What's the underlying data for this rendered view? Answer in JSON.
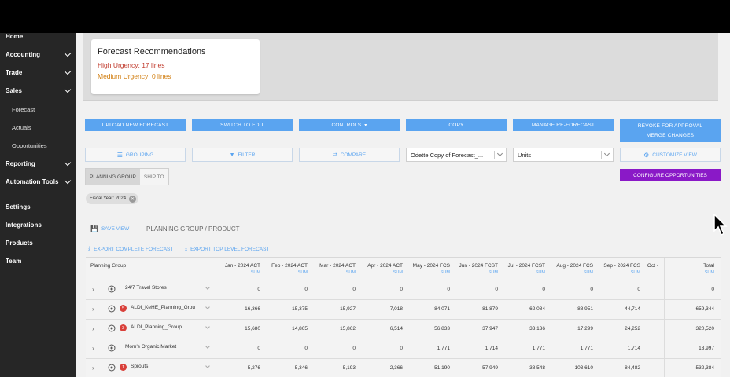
{
  "sidebar": {
    "items": [
      {
        "label": "Home",
        "chevron": false
      },
      {
        "label": "Accounting",
        "chevron": true
      },
      {
        "label": "Trade",
        "chevron": true
      },
      {
        "label": "Sales",
        "chevron": true,
        "expanded": true
      },
      {
        "label": "Reporting",
        "chevron": true
      },
      {
        "label": "Automation Tools",
        "chevron": true
      },
      {
        "label": "Settings",
        "chevron": false
      },
      {
        "label": "Integrations",
        "chevron": false
      },
      {
        "label": "Products",
        "chevron": false
      },
      {
        "label": "Team",
        "chevron": false
      }
    ],
    "sales_sub": [
      "Forecast",
      "Actuals",
      "Opportunities"
    ]
  },
  "recommendations": {
    "title": "Forecast Recommendations",
    "high": "High Urgency: 17 lines",
    "medium": "Medium Urgency: 0 lines"
  },
  "buttons": {
    "upload": "Upload New Forecast",
    "switch": "Switch to Edit",
    "controls": "Controls",
    "copy": "Copy",
    "manage": "Manage Re-Forecast",
    "revoke": "Revoke for Approval",
    "merge": "Merge Changes",
    "grouping": "Grouping",
    "filter": "Filter",
    "compare": "Compare",
    "customize": "Customize View",
    "configure": "Configure Opportunities"
  },
  "selects": {
    "forecast": "Odette Copy of Forecast_...",
    "units": "Units"
  },
  "toggle": {
    "on": "Planning Group",
    "off": "Ship To"
  },
  "chip": "Fiscal Year: 2024",
  "view": {
    "save": "Save View",
    "crumb": "Planning Group / Product",
    "export_complete": "Export Complete Forecast",
    "export_top": "Export Top Level Forecast"
  },
  "table": {
    "first_col": "Planning Group",
    "sum_label": "SUM",
    "columns": [
      "Jan - 2024 ACT",
      "Feb - 2024 ACT",
      "Mar - 2024 ACT",
      "Apr - 2024 ACT",
      "May - 2024 FCS",
      "Jun - 2024 FCST",
      "Jul - 2024 FCST",
      "Aug - 2024 FCS",
      "Sep - 2024 FCS",
      "Oct -",
      "Total"
    ],
    "rows": [
      {
        "name": "24/7 Travel Stores",
        "badge": "",
        "values": [
          "0",
          "0",
          "0",
          "0",
          "0",
          "0",
          "0",
          "0",
          "0",
          "",
          "0"
        ]
      },
      {
        "name": "ALDI_KeHE_Planning_Grou",
        "badge": "5",
        "values": [
          "16,366",
          "15,375",
          "15,927",
          "7,018",
          "84,071",
          "81,879",
          "62,084",
          "88,951",
          "44,714",
          "",
          "659,344"
        ]
      },
      {
        "name": "ALDI_Planning_Group",
        "badge": "3",
        "values": [
          "15,680",
          "14,865",
          "15,862",
          "6,514",
          "56,833",
          "37,947",
          "33,136",
          "17,299",
          "24,252",
          "",
          "320,520"
        ]
      },
      {
        "name": "Mom's Organic Market",
        "badge": "",
        "values": [
          "0",
          "0",
          "0",
          "0",
          "1,771",
          "1,714",
          "1,771",
          "1,771",
          "1,714",
          "",
          "13,997"
        ]
      },
      {
        "name": "Sprouts",
        "badge": "1",
        "values": [
          "5,276",
          "5,346",
          "5,193",
          "2,366",
          "51,190",
          "57,949",
          "38,548",
          "103,610",
          "84,482",
          "",
          "532,384"
        ]
      }
    ]
  },
  "colors": {
    "accent": "#5aa4f0",
    "purple": "#8a19c7",
    "sidebar": "#262626",
    "high": "#c0392b",
    "medium": "#d17e10"
  }
}
